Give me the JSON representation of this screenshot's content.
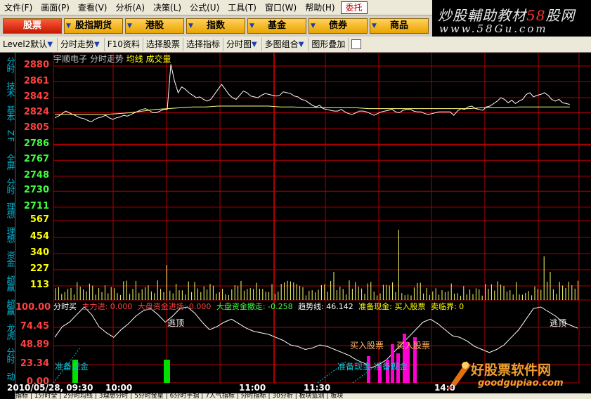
{
  "menu": {
    "items": [
      "文件(F)",
      "画面(P)",
      "查看(V)",
      "分析(A)",
      "决策(L)",
      "公式(U)",
      "工具(T)",
      "窗口(W)",
      "帮助(H)",
      "委托"
    ]
  },
  "brand": {
    "title_prefix": "炒股輔助教材",
    "title_accent": "58",
    "title_suffix": "股网",
    "url": "www.58Gu.com"
  },
  "categories": [
    "股票",
    "股指期货",
    "港股",
    "指数",
    "基金",
    "债券",
    "商品"
  ],
  "toolbar": {
    "items": [
      "Level2默认",
      "分时走势",
      "F10资料",
      "选择股票",
      "选择指标",
      "分时图",
      "多图组合",
      "图形叠加"
    ]
  },
  "left_tabs": [
    "分时",
    "技术",
    "基本",
    "Z F",
    "全屏",
    "分时",
    "理想",
    "理想",
    "资金",
    "超赢",
    "超赢",
    "龙虎",
    "分时",
    "动"
  ],
  "chart_header": {
    "stock": "宇顺电子 分时走势",
    "avg": "均线",
    "vol": "成交量"
  },
  "price_axis": [
    "2880",
    "2861",
    "2842",
    "2824",
    "2805",
    "2786",
    "2767",
    "2748",
    "2730",
    "2711"
  ],
  "volume_axis": [
    "567",
    "454",
    "340",
    "227",
    "113"
  ],
  "indicator_axis": [
    "100.00",
    "74.45",
    "48.89",
    "23.34",
    "0.00"
  ],
  "indicator_bar": {
    "name": "分时买",
    "item1": "主力进: 0.000",
    "item2": "大盘资金进场: 0.000",
    "item3": "大盘资金撤走: -0.258",
    "item4": "趋势线: 46.142",
    "item5": "准备现金: 买入股票",
    "item6": "卖临界: 0"
  },
  "annotations": {
    "escape1": "逃顶",
    "escape2": "逃顶",
    "buy1": "买入股票",
    "buy2": "买入股票",
    "cash1": "准备现金",
    "cash2": "准备现金 准备现金"
  },
  "time_axis": [
    "2010/05/28, 09:30",
    "10:00",
    "11:00",
    "11:30",
    "14:0"
  ],
  "watermark": {
    "cn": "好股票软件网",
    "url": "goodgupiao.com"
  },
  "statusbar": "指标 | 1分时全 | 2分时均线 | 3理想分时 | 5分时金星 | 6分时手指 | 7人气指标 | 分时指标 | 30分析 | 板块监测 | 板块",
  "colors": {
    "grid": "#b00000",
    "price_up": "#ff4040",
    "price_down": "#40ff40",
    "price_line": "#ffffff",
    "avg_line": "#ffff80",
    "volume": "#ffff66",
    "axis_text_up": "#ff4040",
    "axis_text_down": "#40ff40",
    "axis_text_vol": "#ffff00",
    "indicator_axis": "#ff4040"
  },
  "chart_data": {
    "type": "line",
    "title": "宇顺电子 分时走势",
    "xlabel": "",
    "ylabel": "",
    "price": [
      2818,
      2820,
      2823,
      2826,
      2824,
      2822,
      2820,
      2818,
      2817,
      2815,
      2813,
      2816,
      2818,
      2819,
      2821,
      2818,
      2816,
      2818,
      2819,
      2821,
      2820,
      2822,
      2824,
      2826,
      2828,
      2829,
      2827,
      2824,
      2824,
      2826,
      2828,
      2828,
      2882,
      2862,
      2848,
      2855,
      2852,
      2848,
      2845,
      2842,
      2843,
      2840,
      2838,
      2840,
      2846,
      2852,
      2858,
      2852,
      2846,
      2842,
      2840,
      2845,
      2850,
      2848,
      2844,
      2843,
      2842,
      2845,
      2847,
      2846,
      2845,
      2844,
      2845,
      2849,
      2848,
      2847,
      2844,
      2843,
      2840,
      2839,
      2836,
      2833,
      2831,
      2833,
      2829,
      2828,
      2827,
      2826,
      2826,
      2828,
      2825,
      2823,
      2822,
      2824,
      2826,
      2826,
      2825,
      2823,
      2821,
      2823,
      2825,
      2826,
      2827,
      2828,
      2825,
      2824,
      2827,
      2828,
      2828,
      2826,
      2825,
      2825,
      2823,
      2822,
      2823,
      2824,
      2825,
      2825,
      2825,
      2825,
      2821,
      2826,
      2829,
      2828,
      2831,
      2832,
      2829,
      2828,
      2827,
      2831,
      2832,
      2835,
      2838,
      2842,
      2840,
      2836,
      2839,
      2835,
      2838,
      2840,
      2846,
      2848,
      2843,
      2845,
      2846,
      2848,
      2845,
      2840,
      2838,
      2840,
      2836,
      2835,
      2834
    ],
    "avg": [
      2822,
      2822,
      2822,
      2822,
      2822,
      2823,
      2824,
      2826,
      2828,
      2829,
      2830,
      2831,
      2831,
      2832,
      2832,
      2832,
      2832,
      2832,
      2831,
      2831,
      2830,
      2830,
      2830,
      2830,
      2830,
      2829,
      2829,
      2829,
      2829,
      2829,
      2829,
      2829,
      2829,
      2829,
      2830,
      2830,
      2830,
      2831,
      2831,
      2831,
      2831,
      2831
    ],
    "ylim": [
      2705,
      2885
    ],
    "volume_ylim": [
      0,
      600
    ],
    "indicator_ylim": [
      0,
      100
    ]
  }
}
